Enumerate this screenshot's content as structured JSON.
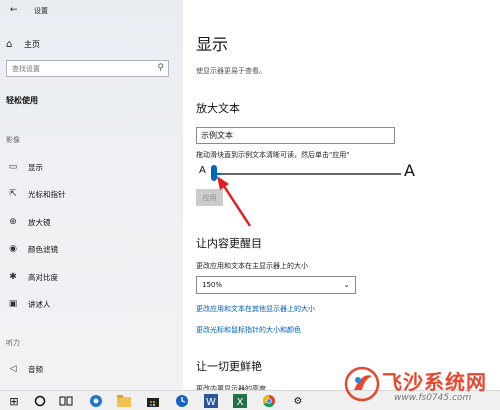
{
  "window": {
    "title": "设置"
  },
  "sidebar": {
    "home": "主页",
    "search_placeholder": "查找设置",
    "category": "轻松使用",
    "sections": [
      {
        "header": "影像",
        "items": [
          "显示",
          "光标和指针",
          "放大镜",
          "颜色滤镜",
          "高对比度",
          "讲述人"
        ]
      },
      {
        "header": "听力",
        "items": [
          "音频"
        ]
      }
    ]
  },
  "main": {
    "title": "显示",
    "description": "使显示器更易于查看。",
    "enlarge": {
      "heading": "放大文本",
      "sample_text": "示例文本",
      "hint": "拖动滑块直到示例文本清晰可读，然后单击\"应用\"",
      "small_a": "A",
      "large_a": "A",
      "slider_value_percent": 5,
      "apply_label": "应用"
    },
    "prominent": {
      "heading": "让内容更醒目",
      "size_label": "更改应用和文本在主显示器上的大小",
      "size_value": "150%",
      "link1": "更改应用和文本在其他显示器上的大小",
      "link2": "更改光标和鼠标指针的大小和颜色"
    },
    "vivid": {
      "heading": "让一切更鲜艳",
      "cut_text": "更改内置显示器的亮度"
    }
  },
  "taskbar": {
    "icons": [
      "windows-start-icon",
      "cortana-circle-icon",
      "task-view-icon",
      "edge-browser-icon",
      "file-explorer-icon",
      "store-icon",
      "clock-app-icon",
      "word-icon",
      "excel-icon",
      "chrome-icon",
      "settings-gear-icon"
    ]
  },
  "watermark": {
    "text": "飞沙系统网",
    "url": "www.fs0745.com"
  },
  "colors": {
    "accent": "#0067c0",
    "arrow": "#e02020",
    "link": "#0060b8",
    "watermark": "#e8472e"
  }
}
